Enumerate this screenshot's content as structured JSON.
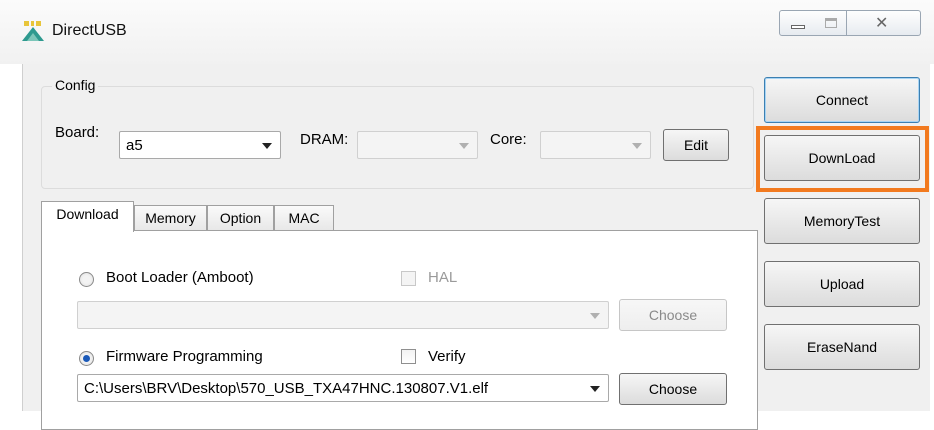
{
  "window": {
    "title": "DirectUSB",
    "icon": "app-logo-icon",
    "controls": [
      "minimize-icon",
      "maximize-icon",
      "close-icon"
    ],
    "close_glyph": "✕"
  },
  "config": {
    "legend": "Config",
    "board_label": "Board:",
    "board_value": "a5",
    "dram_label": "DRAM:",
    "dram_value": "",
    "core_label": "Core:",
    "core_value": "",
    "edit_label": "Edit"
  },
  "tabs": [
    {
      "label": "Download",
      "active": true
    },
    {
      "label": "Memory"
    },
    {
      "label": "Option"
    },
    {
      "label": "MAC"
    }
  ],
  "download_tab": {
    "boot_loader_label": "Boot Loader (Amboot)",
    "hal_label": "HAL",
    "boot_loader_path": "",
    "choose1_label": "Choose",
    "firmware_label": "Firmware Programming",
    "verify_label": "Verify",
    "firmware_path": "C:\\Users\\BRV\\Desktop\\570_USB_TXA47HNC.130807.V1.elf",
    "choose2_label": "Choose"
  },
  "actions": {
    "connect": "Connect",
    "download": "DownLoad",
    "memorytest": "MemoryTest",
    "upload": "Upload",
    "erasenand": "EraseNand"
  },
  "colors": {
    "highlight": "#f27a1f",
    "radio_selected": "#1a59b8"
  }
}
